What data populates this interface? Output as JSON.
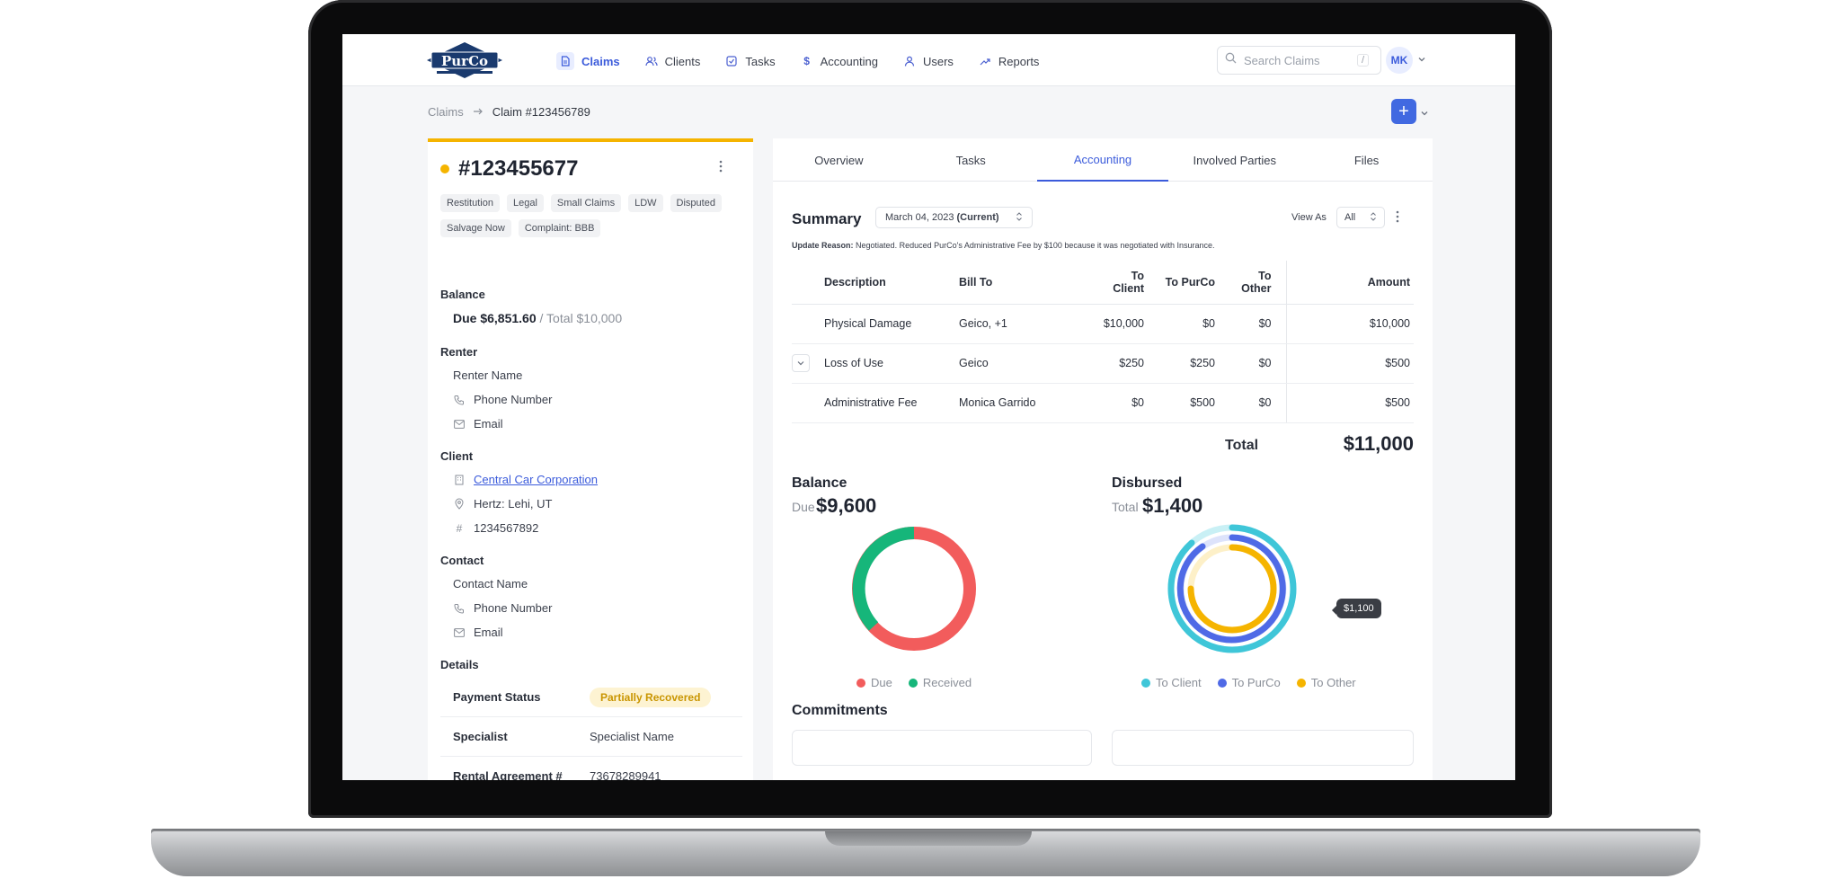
{
  "brand": {
    "logo_text": "PurCo"
  },
  "nav": {
    "items": [
      {
        "label": "Claims",
        "icon": "document-icon",
        "active": true
      },
      {
        "label": "Clients",
        "icon": "users-icon",
        "active": false
      },
      {
        "label": "Tasks",
        "icon": "checklist-icon",
        "active": false
      },
      {
        "label": "Accounting",
        "icon": "dollar-icon",
        "active": false
      },
      {
        "label": "Users",
        "icon": "user-icon",
        "active": false
      },
      {
        "label": "Reports",
        "icon": "trend-icon",
        "active": false
      }
    ]
  },
  "search": {
    "placeholder": "Search Claims",
    "shortcut": "/"
  },
  "user": {
    "initials": "MK"
  },
  "breadcrumb": {
    "root": "Claims",
    "current": "Claim #123456789"
  },
  "claim": {
    "number": "#123455677",
    "tags": [
      "Restitution",
      "Legal",
      "Small Claims",
      "LDW",
      "Disputed",
      "Salvage Now",
      "Complaint: BBB"
    ],
    "balance": {
      "title": "Balance",
      "due": "Due $6,851.60",
      "total": " / Total $10,000"
    },
    "renter": {
      "title": "Renter",
      "name": "Renter Name",
      "phone": "Phone Number",
      "email": "Email"
    },
    "client": {
      "title": "Client",
      "name": "Central Car Corporation",
      "location": "Hertz: Lehi, UT",
      "id": "1234567892"
    },
    "contact": {
      "title": "Contact",
      "name": "Contact Name",
      "phone": "Phone Number",
      "email": "Email"
    },
    "details": {
      "title": "Details",
      "rows": [
        {
          "label": "Payment Status",
          "value": "Partially Recovered"
        },
        {
          "label": "Specialist",
          "value": "Specialist Name"
        },
        {
          "label": "Rental Agreement #",
          "value": "73678289941"
        }
      ]
    }
  },
  "tabs": [
    "Overview",
    "Tasks",
    "Accounting",
    "Involved Parties",
    "Files"
  ],
  "summary": {
    "title": "Summary",
    "date": "March 04, 2023",
    "date_suffix": "(Current)",
    "view_as_label": "View As",
    "view_as_value": "All",
    "update_reason_label": "Update Reason:",
    "update_reason": "Negotiated. Reduced PurCo's Administrative Fee by $100 because it was negotiated with Insurance.",
    "columns": {
      "description": "Description",
      "bill_to": "Bill To",
      "to_client": "To Client",
      "to_purco": "To PurCo",
      "to_other": "To Other",
      "amount": "Amount"
    },
    "rows": [
      {
        "description": "Physical Damage",
        "bill_to": "Geico, +1",
        "to_client": "$10,000",
        "to_purco": "$0",
        "to_other": "$0",
        "amount": "$10,000"
      },
      {
        "description": "Loss of Use",
        "bill_to": "Geico",
        "to_client": "$250",
        "to_purco": "$250",
        "to_other": "$0",
        "amount": "$500"
      },
      {
        "description": "Administrative Fee",
        "bill_to": "Monica Garrido",
        "to_client": "$0",
        "to_purco": "$500",
        "to_other": "$0",
        "amount": "$500"
      }
    ],
    "total_label": "Total",
    "total_value": "$11,000"
  },
  "balance_block": {
    "title": "Balance",
    "sub": "Due",
    "value": "$9,600",
    "legend": [
      "Due",
      "Received"
    ]
  },
  "disbursed_block": {
    "title": "Disbursed",
    "sub": "Total",
    "value": "$1,400",
    "legend": [
      "To Client",
      "To PurCo",
      "To Other"
    ],
    "tooltip": "$1,100"
  },
  "commitments": {
    "title": "Commitments"
  },
  "colors": {
    "accent": "#3b5bdb",
    "due": "#f25c5c",
    "received": "#16b67a",
    "to_client": "#3fc6d8",
    "to_purco": "#4f6ae6",
    "to_other": "#f5b400",
    "status": "#f5b400"
  }
}
